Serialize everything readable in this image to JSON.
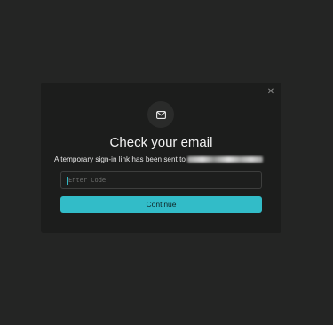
{
  "modal": {
    "close_glyph": "✕",
    "icon": "mail-icon",
    "title": "Check your email",
    "subtitle": "A temporary sign-in link has been sent to",
    "code_input": {
      "placeholder": "Enter Code",
      "value": ""
    },
    "continue_label": "Continue"
  },
  "colors": {
    "accent": "#32bcc8",
    "background": "#242524",
    "modal_background": "#1c1d1c",
    "text_primary": "#f2f2f2"
  }
}
